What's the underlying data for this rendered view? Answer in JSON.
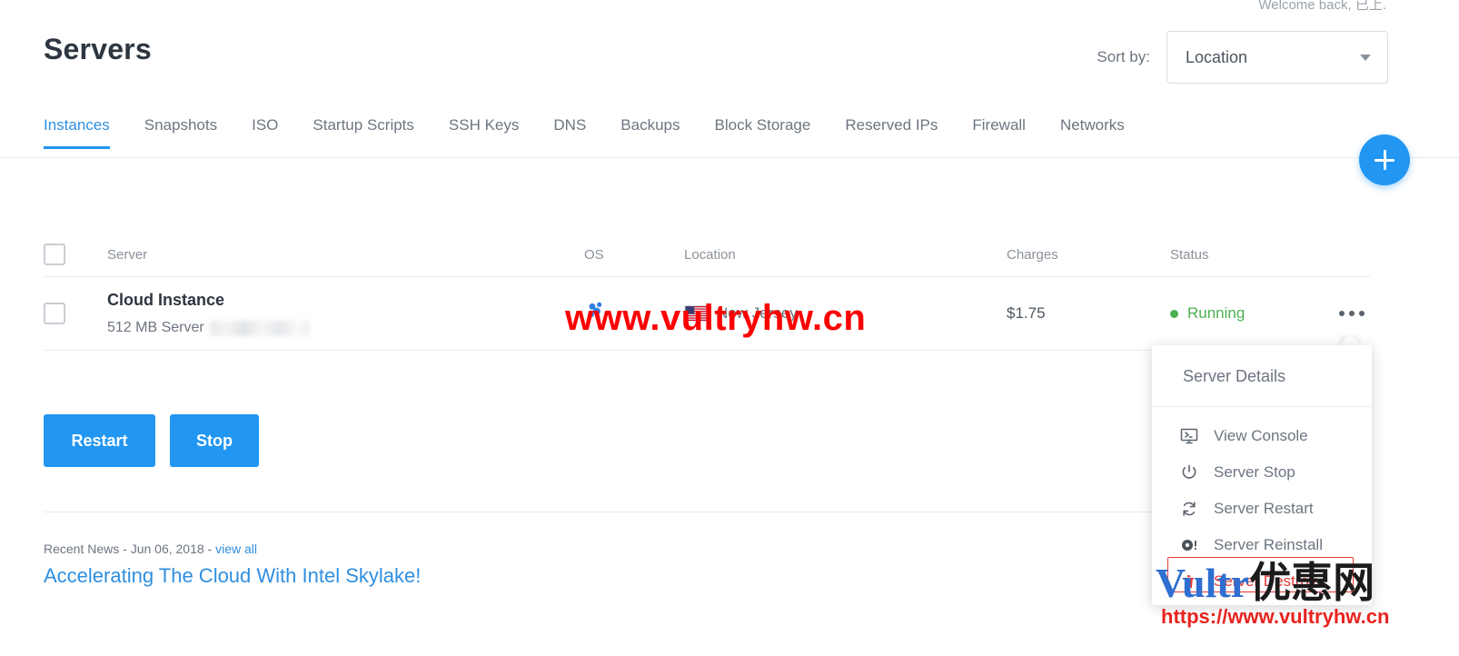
{
  "header": {
    "welcome_text": "Welcome back, 已上.",
    "page_title": "Servers",
    "sort_label": "Sort by:",
    "sort_value": "Location",
    "caret_icon": "chevron-down-icon",
    "add_button_icon": "plus-icon"
  },
  "tabs": [
    {
      "label": "Instances",
      "active": true
    },
    {
      "label": "Snapshots",
      "active": false
    },
    {
      "label": "ISO",
      "active": false
    },
    {
      "label": "Startup Scripts",
      "active": false
    },
    {
      "label": "SSH Keys",
      "active": false
    },
    {
      "label": "DNS",
      "active": false
    },
    {
      "label": "Backups",
      "active": false
    },
    {
      "label": "Block Storage",
      "active": false
    },
    {
      "label": "Reserved IPs",
      "active": false
    },
    {
      "label": "Firewall",
      "active": false
    },
    {
      "label": "Networks",
      "active": false
    }
  ],
  "table": {
    "columns": {
      "server": "Server",
      "os": "OS",
      "location": "Location",
      "charges": "Charges",
      "status": "Status"
    },
    "rows": [
      {
        "name": "Cloud Instance",
        "plan": "512 MB Server",
        "ip_redacted": true,
        "os_icon": "coreos-icon",
        "location_flag": "us-flag-icon",
        "location": "New Jersey",
        "charges": "$1.75",
        "status": "Running",
        "status_color": "#4caf50",
        "more_icon": "ellipsis-icon"
      }
    ]
  },
  "actions": {
    "restart_label": "Restart",
    "stop_label": "Stop"
  },
  "news": {
    "meta_prefix": "Recent News - Jun 06, 2018 - ",
    "view_all_label": "view all",
    "headline": "Accelerating The Cloud With Intel Skylake!"
  },
  "menu": {
    "header_label": "Server Details",
    "items": [
      {
        "label": "View Console",
        "icon": "console-icon",
        "danger": false
      },
      {
        "label": "Server Stop",
        "icon": "power-icon",
        "danger": false
      },
      {
        "label": "Server Restart",
        "icon": "restart-icon",
        "danger": false
      },
      {
        "label": "Server Reinstall",
        "icon": "reinstall-icon",
        "danger": false
      },
      {
        "label": "Server Destroy",
        "icon": "trash-icon",
        "danger": true
      }
    ]
  },
  "watermarks": {
    "center": "www.vultryhw.cn",
    "logo_latin": "Vultr",
    "logo_cn": "优惠网",
    "url": "https://www.vultryhw.cn"
  },
  "colors": {
    "accent": "#2196f3",
    "link": "#2f8fe0",
    "status_running": "#4caf50",
    "danger": "#e53935",
    "watermark_red": "#fb0202"
  }
}
